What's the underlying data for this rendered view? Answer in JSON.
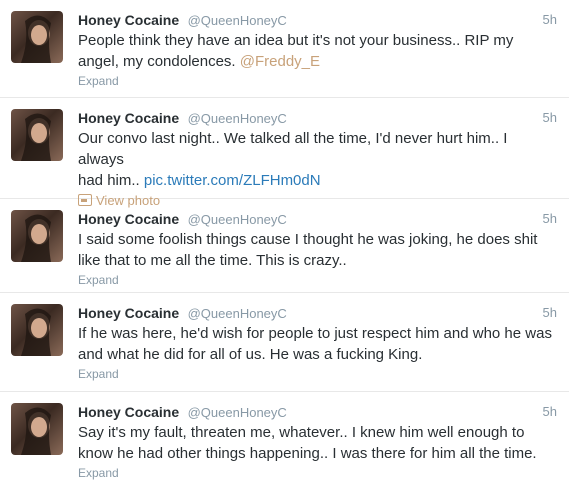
{
  "colors": {
    "link": "#2b7bb9",
    "mention": "#c8a27a",
    "muted": "#8899a6",
    "text": "#292f33"
  },
  "tweets": [
    {
      "name": "Honey Cocaine",
      "handle": "@QueenHoneyC",
      "time": "5h",
      "text_line1": "People think they have an idea but it's not your business.. RIP my",
      "text_line2": "angel, my condolences. ",
      "mention": "@Freddy_E",
      "action": "Expand"
    },
    {
      "name": "Honey Cocaine",
      "handle": "@QueenHoneyC",
      "time": "5h",
      "text_line1": "Our convo last night.. We talked all the time, I'd never hurt him.. I always",
      "text_line2": "had him.. ",
      "link": "pic.twitter.com/ZLFHm0dN",
      "action": "View photo",
      "action_icon": "photo-icon"
    },
    {
      "name": "Honey Cocaine",
      "handle": "@QueenHoneyC",
      "time": "5h",
      "text_line1": "I said some foolish things cause I thought he was joking, he does shit",
      "text_line2": "like that to me all the time. This is crazy..",
      "action": "Expand"
    },
    {
      "name": "Honey Cocaine",
      "handle": "@QueenHoneyC",
      "time": "5h",
      "text_line1": "If he was here, he'd wish for people to just respect him and who he was",
      "text_line2": "and what he did for all of us. He was a fucking King.",
      "action": "Expand"
    },
    {
      "name": "Honey Cocaine",
      "handle": "@QueenHoneyC",
      "time": "5h",
      "text_line1": "Say it's my fault, threaten me, whatever.. I knew him well enough to",
      "text_line2": "know he had other things happening.. I was there for him all the time.",
      "action": "Expand"
    }
  ]
}
